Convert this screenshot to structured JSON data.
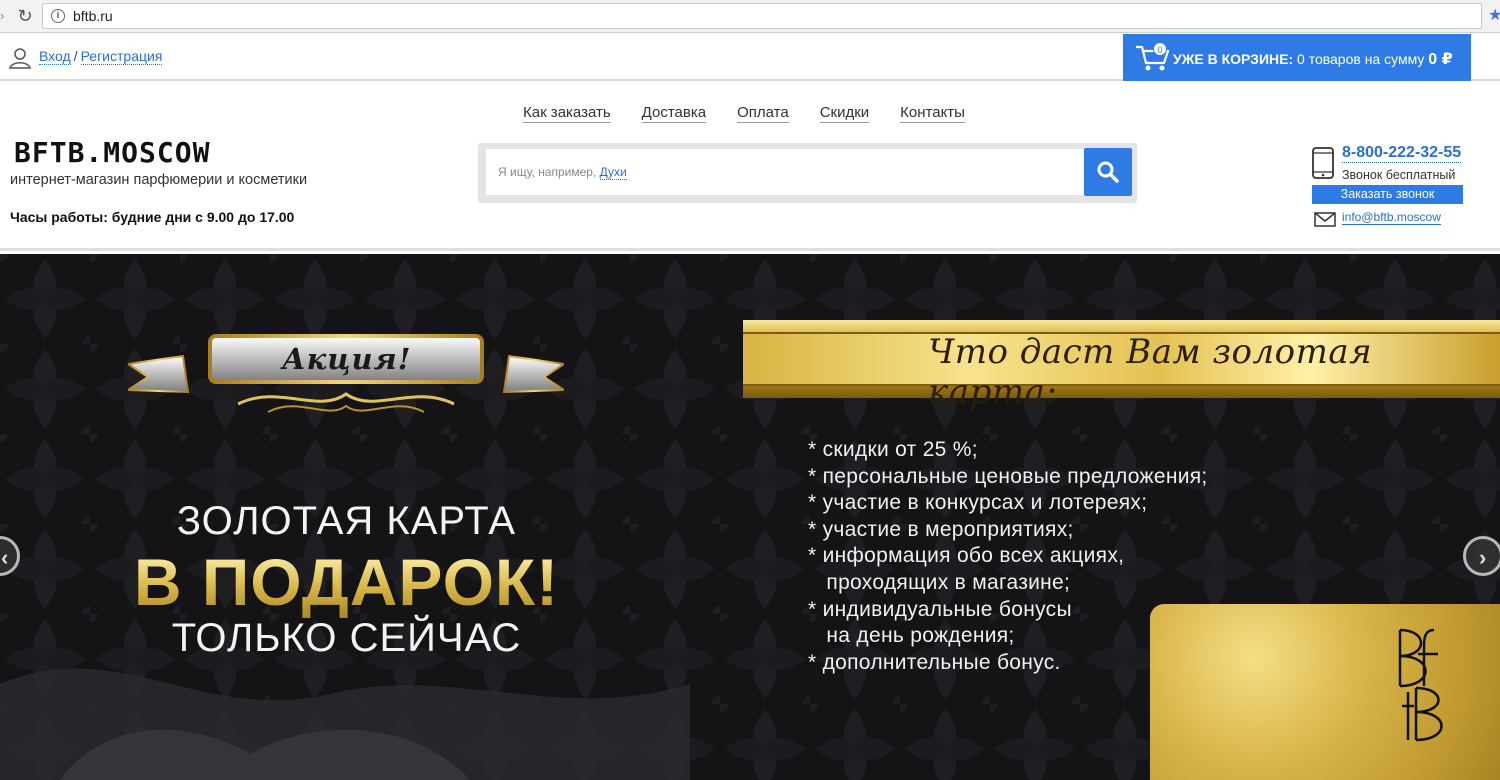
{
  "browser": {
    "url": "bftb.ru"
  },
  "topbar": {
    "login_label": "Вход",
    "separator": "/",
    "register_label": "Регистрация",
    "cart": {
      "count": "0",
      "label": "УЖЕ В КОРЗИНЕ:",
      "text": "0 товаров на сумму",
      "sum": "0 ₽"
    }
  },
  "header": {
    "menu": [
      {
        "label": "Как заказать"
      },
      {
        "label": "Доставка"
      },
      {
        "label": "Оплата"
      },
      {
        "label": "Скидки"
      },
      {
        "label": "Контакты"
      }
    ],
    "logo": "BFTB.MOSCOW",
    "tagline": "интернет-магазин парфюмерии и косметики",
    "hours": "Часы работы: будние дни с 9.00 до 17.00",
    "search": {
      "placeholder": "Я ищу, например,",
      "hint": "Духи"
    },
    "phone": "8-800-222-32-55",
    "phone_note": "Звонок бесплатный",
    "callback_label": "Заказать звонок",
    "email": "info@bftb.moscow"
  },
  "banner": {
    "ribbon_text": "Акция!",
    "gold_title": "Что даст Вам золотая карта:",
    "promo_line1": "ЗОЛОТАЯ КАРТА",
    "promo_line2": "В ПОДАРОК!",
    "promo_line3": "ТОЛЬКО СЕЙЧАС",
    "benefits": [
      "* скидки от 25 %;",
      "* персональные ценовые предложения;",
      "* участие в конкурсах и лотереях;",
      "* участие в мероприятиях;",
      "* информация обо всех акциях,",
      "   проходящих в магазине;",
      "* индивидуальные бонусы",
      "   на день рождения;",
      "* дополнительные бонус."
    ],
    "colors": {
      "accent": "#2f7be6",
      "gold": "#d8b548",
      "background": "#121214"
    }
  }
}
